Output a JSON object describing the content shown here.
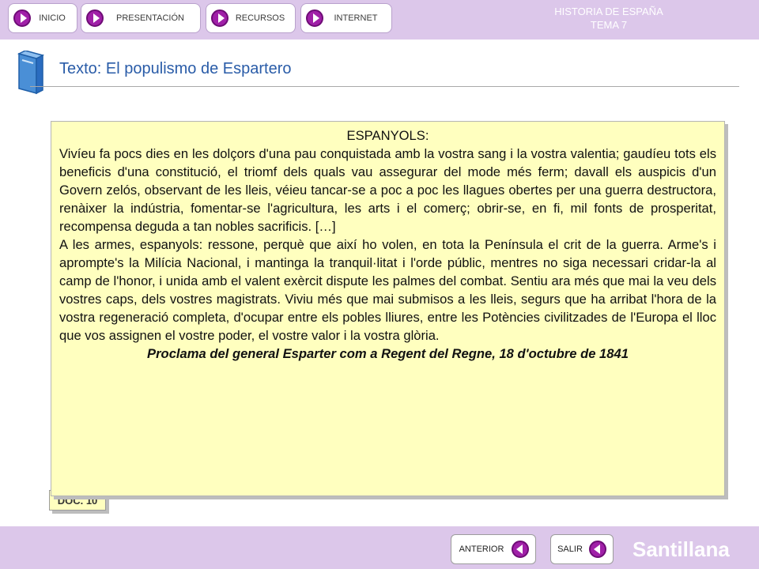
{
  "nav": {
    "items": [
      {
        "label": "INICIO"
      },
      {
        "label": "PRESENTACIÓN"
      },
      {
        "label": "RECURSOS"
      },
      {
        "label": "INTERNET"
      }
    ]
  },
  "header": {
    "line1": "HISTORIA DE ESPAÑA",
    "line2": "TEMA 7"
  },
  "page": {
    "title": "Texto: El populismo de Espartero"
  },
  "document": {
    "heading": "ESPANYOLS:",
    "paragraph1": "Vivíeu fa pocs dies en les dolçors d'una pau conquistada amb la vostra sang i la vostra valentia; gaudíeu tots els beneficis d'una constitució, el triomf dels quals vau assegurar del mode més ferm; davall els auspicis d'un Govern zelós, observant de les lleis, véieu tancar-se a poc a poc les llagues obertes per una guerra destructora, renàixer la indústria, fomentar-se l'agricultura, les arts i el comerç; obrir-se, en fi, mil fonts de prosperitat, recompensa deguda a tan nobles sacrificis. […]",
    "paragraph2": "A les armes, espanyols: ressone, perquè que així ho volen, en tota la Península el crit de la guerra. Arme's i apromptе's la Milícia Nacional, i mantinga la tranquil·litat i l'orde públic, mentres no siga necessari cridar-la al camp de l'honor, i unida amb el valent exèrcit dispute les palmes del combat. Sentiu ara més que mai la veu dels vostres caps, dels vostres magistrats. Viviu més que mai submisos a les lleis, segurs que ha arribat l'hora de la vostra regeneració completa, d'ocupar entre els pobles lliures, entre les Potències civilitzades de l'Europa el lloc que vos assignen el vostre poder, el vostre valor i la vostra glòria.",
    "source": "Proclama del general Esparter com a Regent del Regne, 18 d'octubre de 1841",
    "tag": "DOC. 10"
  },
  "footer": {
    "prev_label": "ANTERIOR",
    "exit_label": "SALIR",
    "brand": "Santillana"
  },
  "colors": {
    "bar": "#dcc7ea",
    "accent": "#a020a8",
    "title": "#2a5ca8",
    "doc_bg": "#ffffbf"
  },
  "icons": {
    "nav": "play-arrow-icon",
    "footer": "back-arrow-icon",
    "heading": "book-icon"
  }
}
